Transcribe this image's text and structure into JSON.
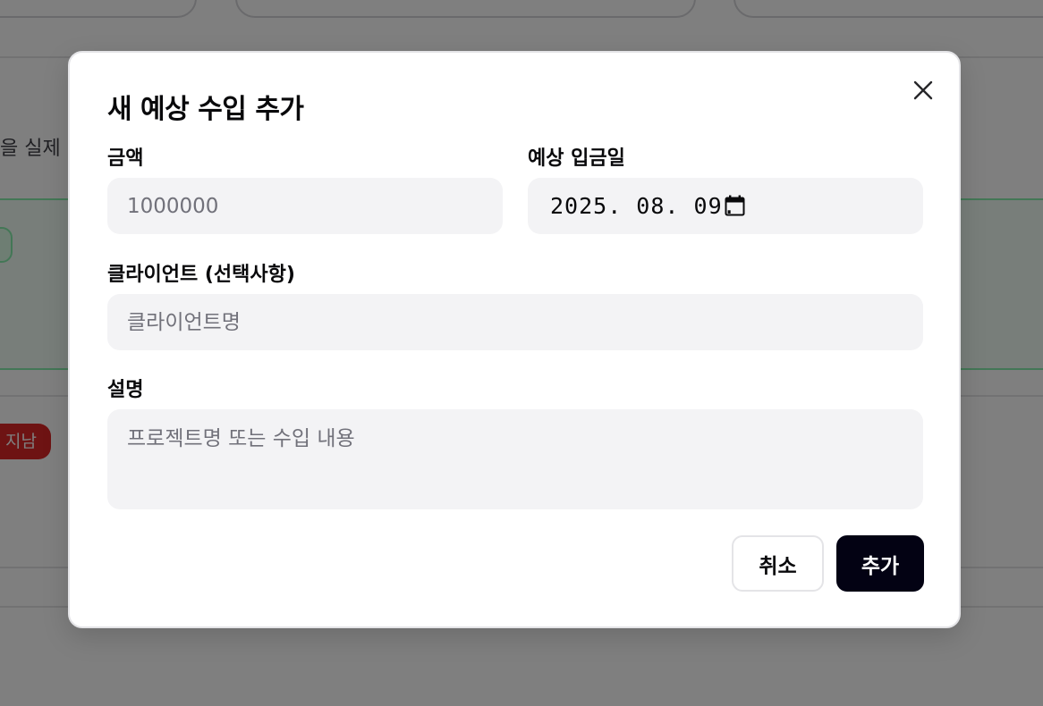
{
  "background": {
    "partial_text": "을 실제",
    "status_badge": "지남"
  },
  "modal": {
    "title": "새 예상 수입 추가",
    "close_icon": "close-icon",
    "amount": {
      "label": "금액",
      "placeholder": "1000000",
      "value": ""
    },
    "expected_date": {
      "label": "예상 입금일",
      "value": "2025. 08. 09.",
      "icon": "calendar-icon"
    },
    "client": {
      "label": "클라이언트 (선택사항)",
      "placeholder": "클라이언트명",
      "value": ""
    },
    "description": {
      "label": "설명",
      "placeholder": "프로젝트명 또는 수입 내용",
      "value": ""
    },
    "buttons": {
      "cancel": "취소",
      "add": "추가"
    }
  },
  "colors": {
    "primary_button": "#030213",
    "input_background": "#f3f3f5",
    "overdue_badge": "#dc2626",
    "success_border": "#86efac"
  }
}
